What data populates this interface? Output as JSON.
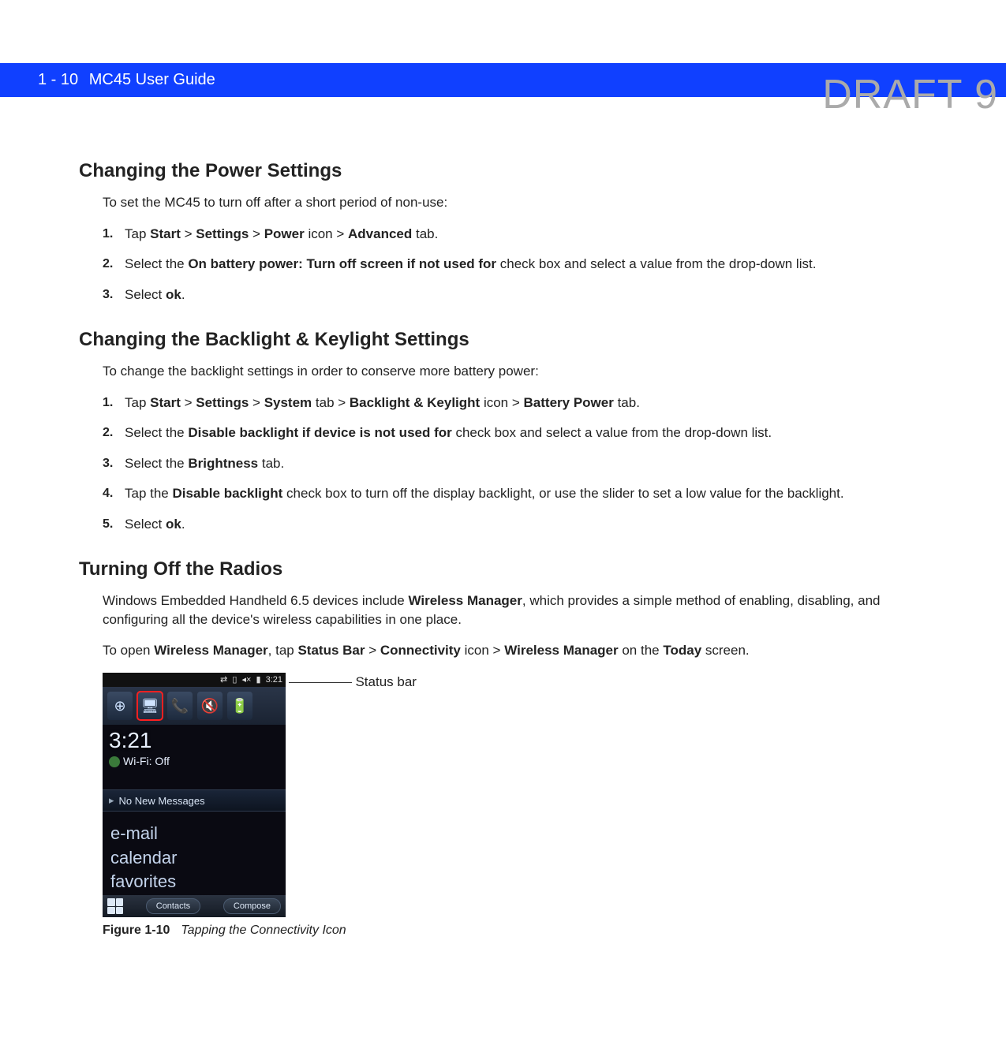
{
  "watermark": "DRAFT 9",
  "header": {
    "page": "1 - 10",
    "title": "MC45 User Guide"
  },
  "section1": {
    "title": "Changing the Power Settings",
    "intro": "To set the MC45 to turn off after a short period of non-use:",
    "step1_pre": "Tap ",
    "step1_b1": "Start",
    "step1_gt1": " > ",
    "step1_b2": "Settings",
    "step1_gt2": " >  ",
    "step1_b3": "Power",
    "step1_mid": " icon > ",
    "step1_b4": "Advanced",
    "step1_post": " tab.",
    "step2_pre": "Select the ",
    "step2_b1": "On battery power: Turn off screen if not used for",
    "step2_post": " check box and select a value from the drop-down list.",
    "step3_pre": "Select ",
    "step3_b1": "ok",
    "step3_post": "."
  },
  "section2": {
    "title": "Changing the Backlight & Keylight Settings",
    "intro": "To change the backlight settings in order to conserve more battery power:",
    "step1_pre": "Tap ",
    "step1_b1": "Start",
    "step1_gt1": " > ",
    "step1_b2": "Settings",
    "step1_gt2": " > ",
    "step1_b3": "System",
    "step1_mid1": " tab > ",
    "step1_b4": "Backlight & Keylight",
    "step1_mid2": " icon > ",
    "step1_b5": "Battery Power",
    "step1_post": " tab.",
    "step2_pre": "Select the ",
    "step2_b1": "Disable backlight if device is not used for",
    "step2_post": " check box and select a value from the drop-down list.",
    "step3_pre": "Select the ",
    "step3_b1": "Brightness",
    "step3_post": " tab.",
    "step4_pre": "Tap the ",
    "step4_b1": "Disable backlight",
    "step4_post": " check box to turn off the display backlight, or use the slider to set a low value for the backlight.",
    "step5_pre": "Select ",
    "step5_b1": "ok",
    "step5_post": "."
  },
  "section3": {
    "title": "Turning Off the Radios",
    "intro_pre": "Windows Embedded Handheld 6.5 devices include ",
    "intro_b1": "Wireless Manager",
    "intro_post": ", which provides a simple method of enabling, disabling, and configuring all the device's wireless capabilities in one place.",
    "open_pre": "To open ",
    "open_b1": "Wireless Manager",
    "open_mid1": ", tap ",
    "open_b2": "Status Bar",
    "open_gt1": " > ",
    "open_b3": "Connectivity",
    "open_mid2": " icon > ",
    "open_b4": "Wireless Manager",
    "open_mid3": " on the ",
    "open_b5": "Today",
    "open_post": " screen."
  },
  "figure": {
    "callout": "Status bar",
    "statusbar_time": "3:21",
    "clock": "3:21",
    "wifi": "Wi-Fi: Off",
    "messages": "No New Messages",
    "link1": "e-mail",
    "link2": "calendar",
    "link3": "favorites",
    "soft_left": "Contacts",
    "soft_right": "Compose",
    "caption_num": "Figure 1-10",
    "caption_title": "Tapping the Connectivity Icon"
  }
}
